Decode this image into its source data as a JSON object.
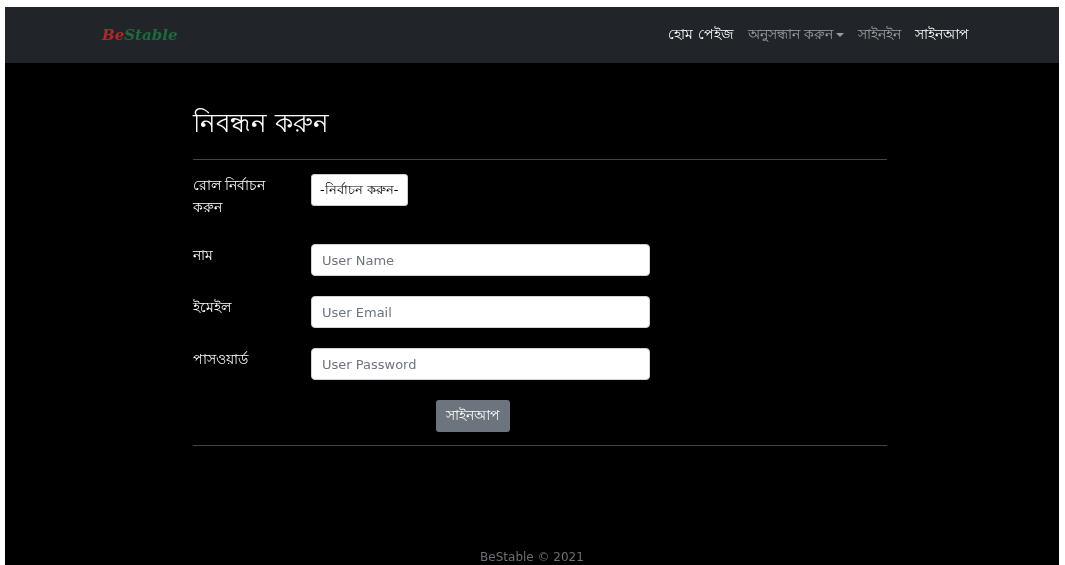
{
  "navbar": {
    "logo": [
      {
        "text": "Be",
        "color": "#b3262b"
      },
      {
        "text": "Stable",
        "color": "#1c6b3c"
      }
    ],
    "items": [
      {
        "label": "হোম পেইজ",
        "selected": true,
        "dropdown": false
      },
      {
        "label": "অনুসন্ধান করুন",
        "selected": false,
        "dropdown": true
      },
      {
        "label": "সাইনইন",
        "selected": false,
        "dropdown": false
      },
      {
        "label": "সাইনআপ",
        "selected": true,
        "dropdown": false
      }
    ]
  },
  "form": {
    "title": "নিবন্ধন করুন",
    "fields": [
      {
        "kind": "select",
        "label": "রোল নির্বাচন করুন",
        "value": "-নির্বাচন করুন-"
      },
      {
        "kind": "text",
        "label": "নাম",
        "placeholder": "User Name"
      },
      {
        "kind": "text",
        "label": "ইমেইল",
        "placeholder": "User Email"
      },
      {
        "kind": "text",
        "label": "পাসওয়ার্ড",
        "placeholder": "User Password"
      }
    ],
    "submit": "সাইনআপ"
  },
  "footer": "BeStable © 2021"
}
